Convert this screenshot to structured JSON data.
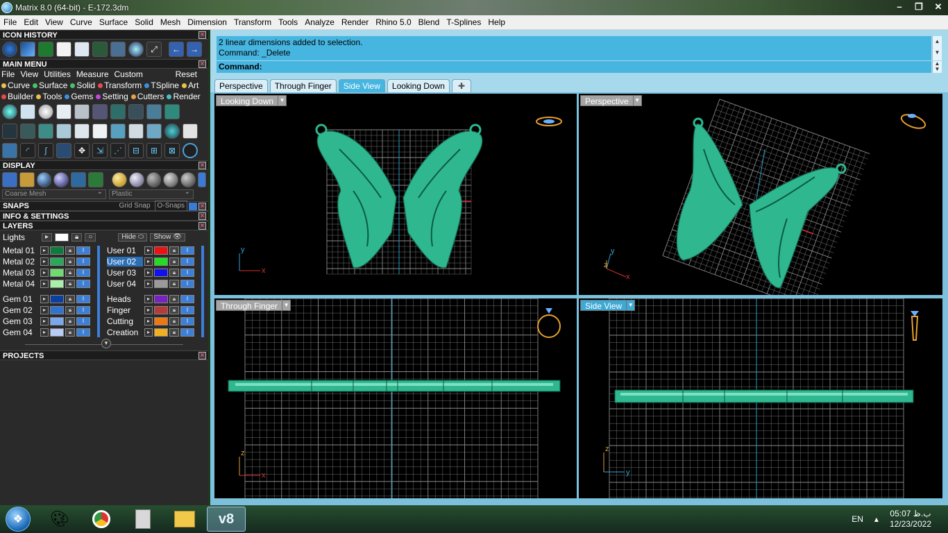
{
  "window": {
    "title": "Matrix 8.0 (64-bit) - E-172.3dm",
    "buttons": [
      "–",
      "❐",
      "✕"
    ]
  },
  "menubar": [
    "File",
    "Edit",
    "View",
    "Curve",
    "Surface",
    "Solid",
    "Mesh",
    "Dimension",
    "Transform",
    "Tools",
    "Analyze",
    "Render",
    "Rhino 5.0",
    "Blend",
    "T-Splines",
    "Help"
  ],
  "left_panel": {
    "icon_history_title": "ICON HISTORY",
    "main_menu_title": "MAIN MENU",
    "main_menu_items": [
      "File",
      "View",
      "Utilities",
      "Measure",
      "Custom"
    ],
    "main_menu_reset": "Reset",
    "categories_row1": [
      {
        "label": "Curve",
        "color": "#e8c24a"
      },
      {
        "label": "Surface",
        "color": "#4ac06a"
      },
      {
        "label": "Solid",
        "color": "#4ac06a"
      },
      {
        "label": "Transform",
        "color": "#e84a4a"
      },
      {
        "label": "TSpline",
        "color": "#3b8fe0"
      },
      {
        "label": "Art",
        "color": "#e8c24a"
      }
    ],
    "categories_row2": [
      {
        "label": "Builder",
        "color": "#e84a4a"
      },
      {
        "label": "Tools",
        "color": "#e8c24a"
      },
      {
        "label": "Gems",
        "color": "#3b8fe0"
      },
      {
        "label": "Setting",
        "color": "#c04ae0"
      },
      {
        "label": "Cutters",
        "color": "#e8a04a"
      },
      {
        "label": "Render",
        "color": "#4ac0c0"
      }
    ],
    "display_title": "DISPLAY",
    "display_mesh": "Coarse Mesh",
    "display_material": "Plastic",
    "snaps_title": "SNAPS",
    "grid_snap": "Grid Snap",
    "o_snaps": "O-Snaps",
    "info_title": "INFO & SETTINGS",
    "layers_title": "LAYERS",
    "lights_label": "Lights",
    "hide_label": "Hide",
    "show_label": "Show",
    "layers_left": [
      {
        "name": "Metal 01",
        "color": "#0e7a3c"
      },
      {
        "name": "Metal 02",
        "color": "#27a85a"
      },
      {
        "name": "Metal 03",
        "color": "#6fdc6f"
      },
      {
        "name": "Metal 04",
        "color": "#a8f0a8"
      },
      {
        "name": "Gem 01",
        "color": "#0b3fa0"
      },
      {
        "name": "Gem 02",
        "color": "#2f72d0"
      },
      {
        "name": "Gem 03",
        "color": "#79a8ee"
      },
      {
        "name": "Gem 04",
        "color": "#b7cdf5"
      }
    ],
    "layers_right": [
      {
        "name": "User 01",
        "color": "#ee1111"
      },
      {
        "name": "User 02",
        "color": "#22dd22"
      },
      {
        "name": "User 03",
        "color": "#1111ee"
      },
      {
        "name": "User 04",
        "color": "#9a9a9a"
      },
      {
        "name": "Heads",
        "color": "#7a22c0"
      },
      {
        "name": "Finger",
        "color": "#b53a3a"
      },
      {
        "name": "Cutting",
        "color": "#ee7711"
      },
      {
        "name": "Creation",
        "color": "#f0b020"
      }
    ],
    "projects_title": "PROJECTS"
  },
  "command": {
    "history_line1": "2 linear dimensions added to selection.",
    "history_line2": "Command: _Delete",
    "prompt": "Command:"
  },
  "tabs": [
    {
      "label": "Perspective",
      "active": false
    },
    {
      "label": "Through Finger",
      "active": false
    },
    {
      "label": "Side View",
      "active": true
    },
    {
      "label": "Looking Down",
      "active": false
    }
  ],
  "viewports": {
    "top_left": "Looking Down",
    "top_right": "Perspective",
    "bottom_left": "Through Finger",
    "bottom_right": "Side View"
  },
  "axes": {
    "x": "x",
    "y": "y",
    "z": "z"
  },
  "taskbar": {
    "language": "EN",
    "time": "05:07 ب.ظ",
    "date": "12/23/2022",
    "active_app": "v8"
  },
  "colors": {
    "model": "#2fb890",
    "grid": "#8a8a8a",
    "accent": "#46b5e0"
  }
}
